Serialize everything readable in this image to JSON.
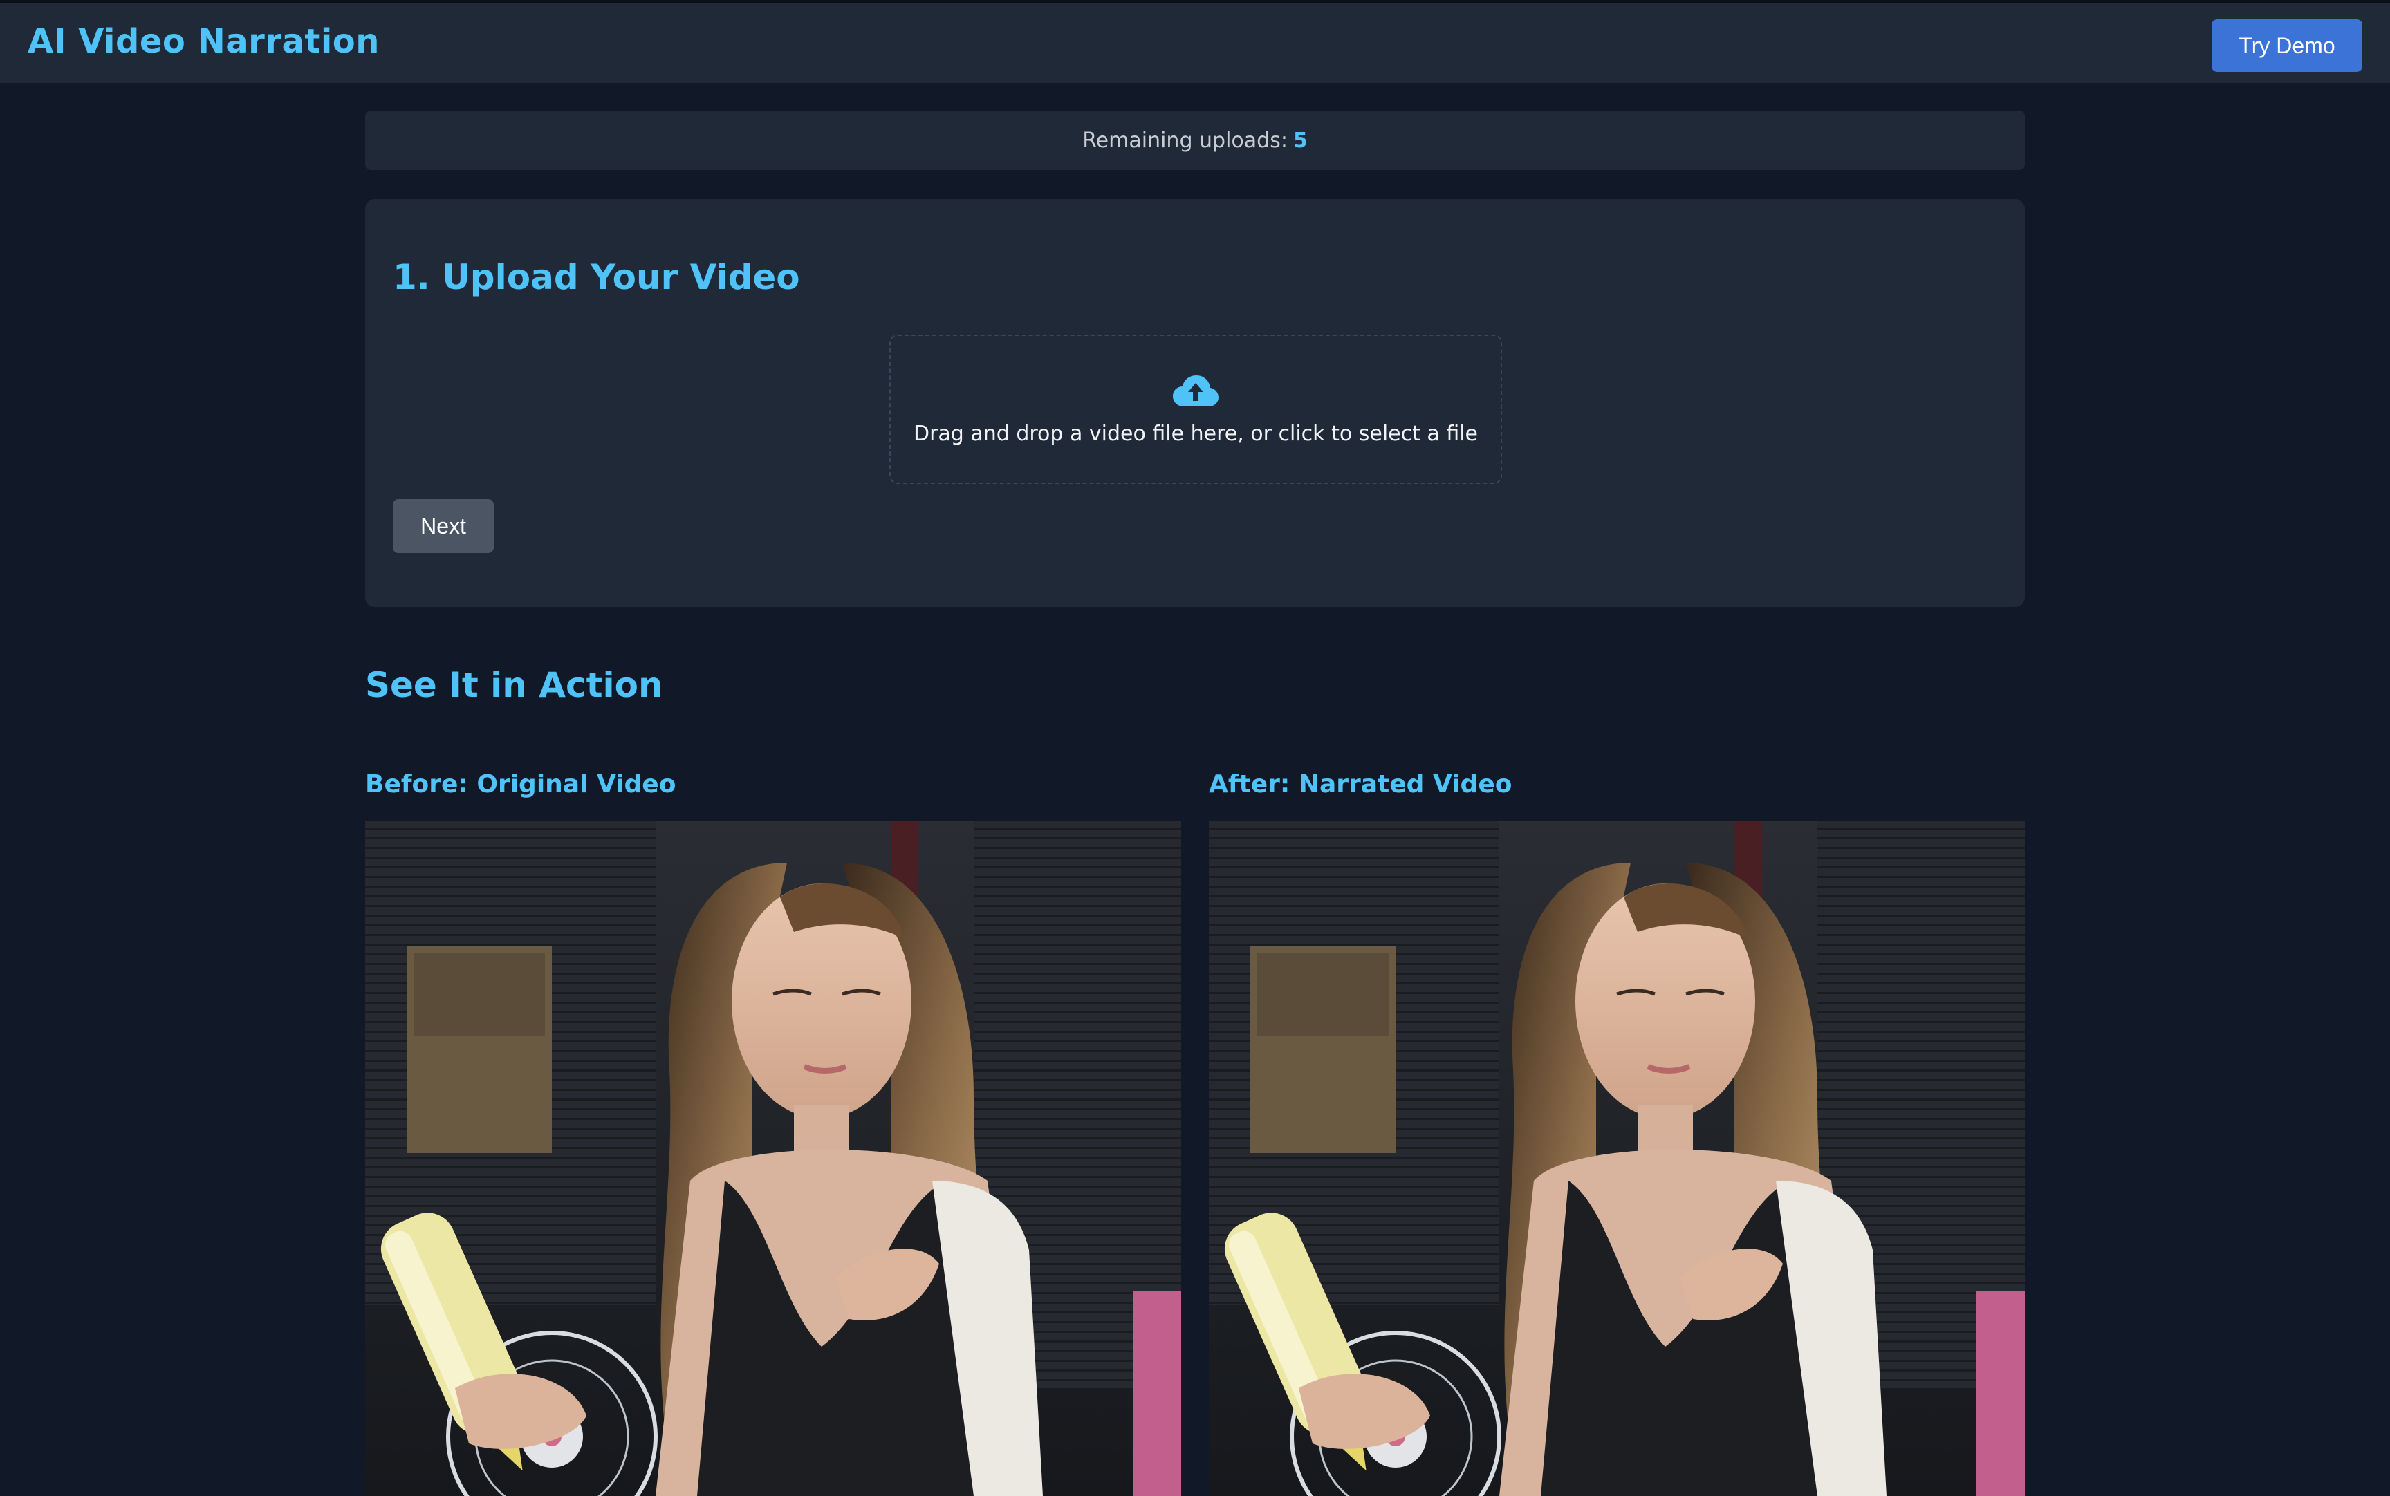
{
  "header": {
    "title": "AI Video Narration",
    "try_demo_label": "Try Demo"
  },
  "uploads": {
    "label": "Remaining uploads:",
    "count": "5"
  },
  "upload_card": {
    "title": "1. Upload Your Video",
    "dropzone_text": "Drag and drop a video file here, or click to select a file",
    "dropzone_icon": "cloud-upload-icon",
    "next_label": "Next"
  },
  "demo": {
    "title": "See It in Action",
    "before_label": "Before: Original Video",
    "after_label": "After: Narrated Video"
  },
  "colors": {
    "background": "#111827",
    "surface": "#1f2937",
    "accent": "#4fc3f7",
    "primary_button": "#3b73d6",
    "secondary_button": "#4b5563"
  }
}
